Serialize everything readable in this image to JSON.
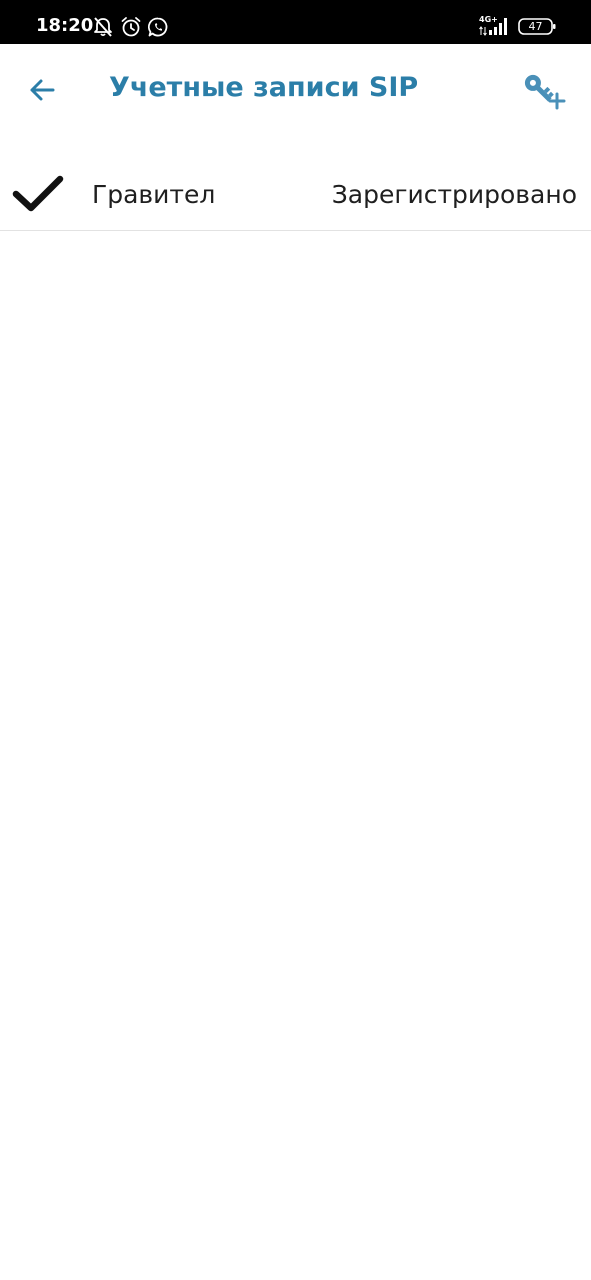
{
  "status_bar": {
    "time": "18:20",
    "network_type": "4G+",
    "battery_level": "47",
    "icons": [
      "bell-off-icon",
      "alarm-clock-icon",
      "whatsapp-icon",
      "signal-icon",
      "battery-icon"
    ]
  },
  "app_bar": {
    "title": "Учетные записи SIP",
    "back_icon": "arrow-left-icon",
    "add_icon": "key-plus-icon"
  },
  "accounts": [
    {
      "name": "Гравител",
      "status": "Зарегистрировано",
      "selected": true,
      "icon": "check-icon"
    }
  ],
  "colors": {
    "accent": "#2b7ea8",
    "icon_accent": "#4a90b8",
    "text": "#1f1f1f",
    "divider": "#e2e2e2",
    "status_bar_bg": "#000000"
  }
}
